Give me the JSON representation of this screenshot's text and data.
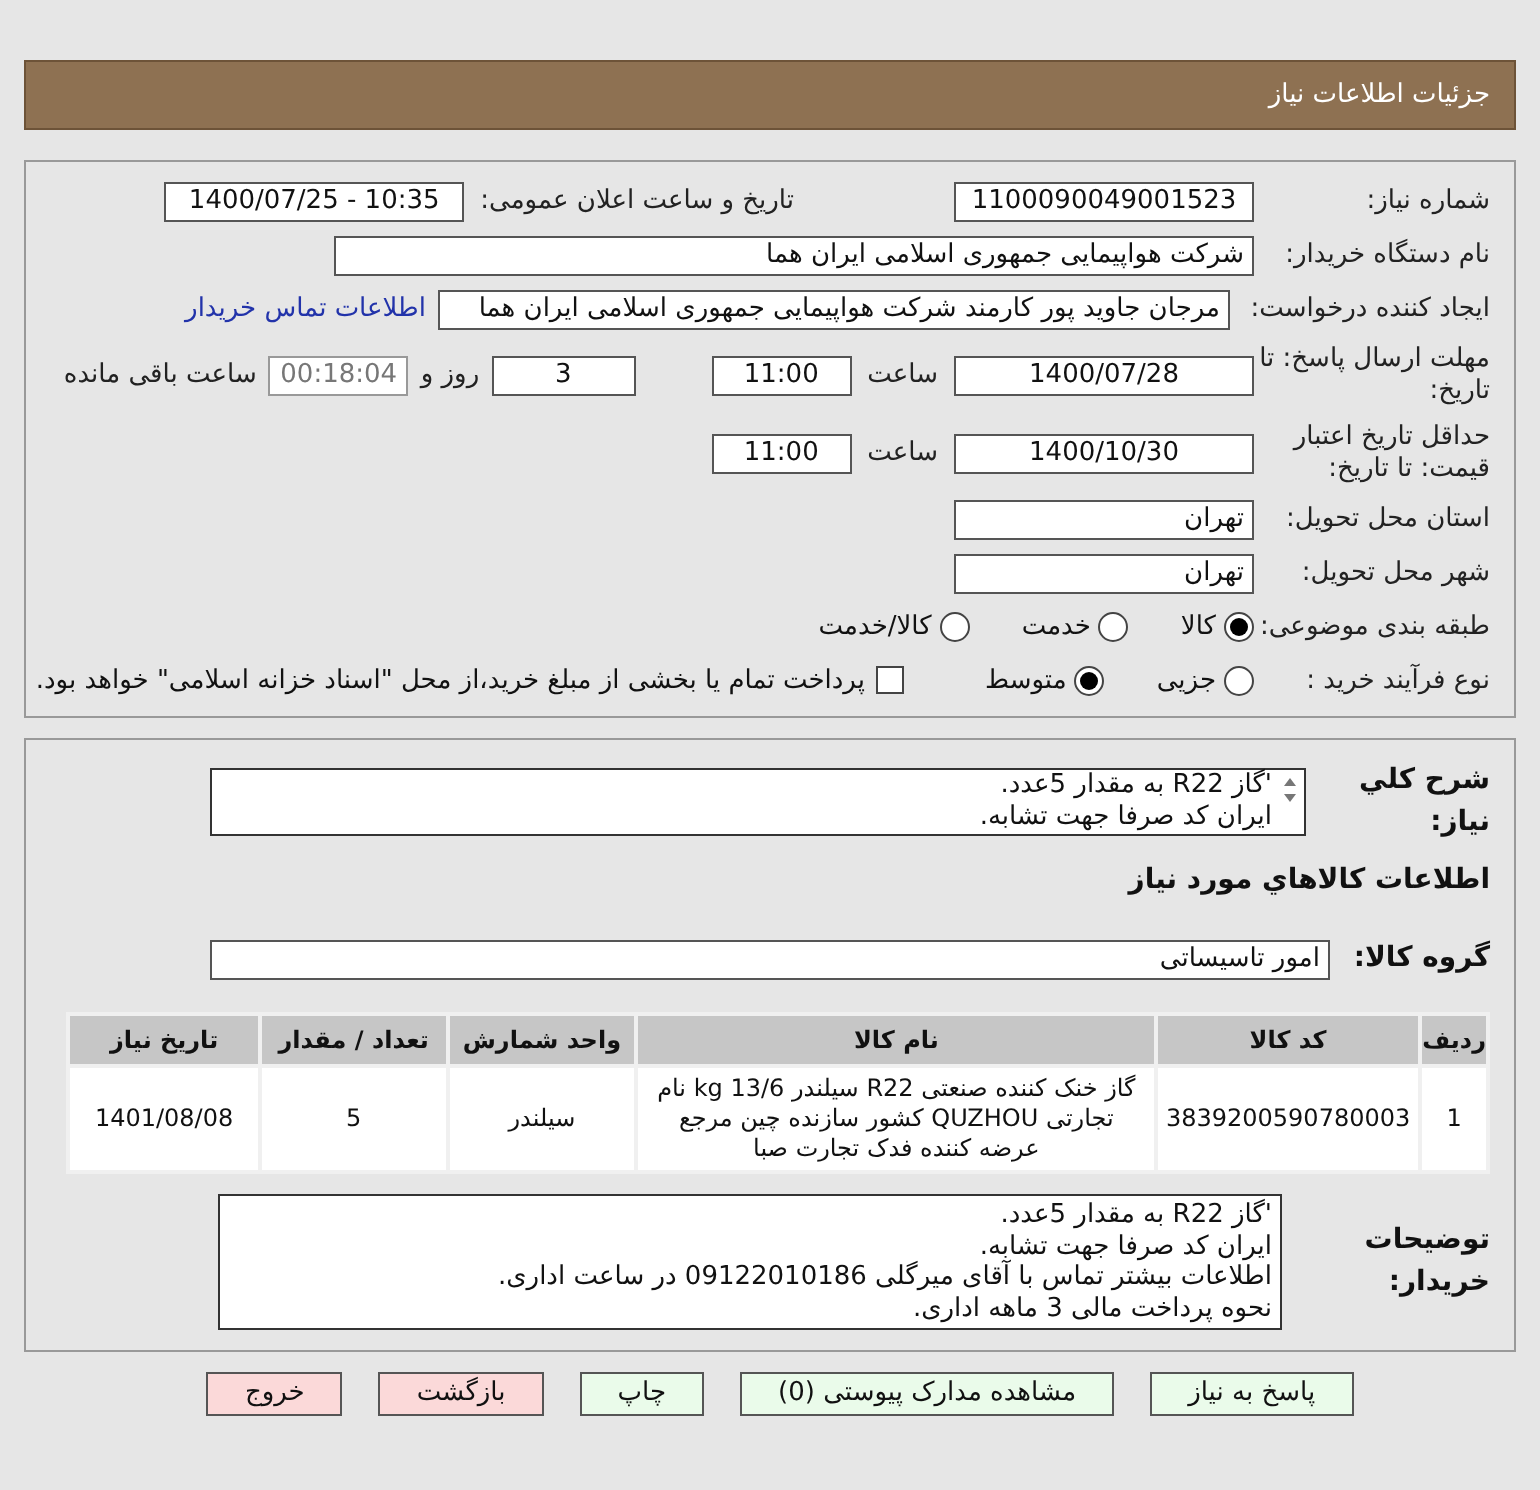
{
  "header": {
    "title": "جزئیات اطلاعات نیاز"
  },
  "info": {
    "need_number": {
      "label": "شماره نیاز:",
      "value": "1100090049001523"
    },
    "announce": {
      "label": "تاریخ و ساعت اعلان عمومی:",
      "value": "1400/07/25 - 10:35"
    },
    "buyer": {
      "label": "نام دستگاه خریدار:",
      "value": "شرکت هواپیمایی جمهوری اسلامی ایران هما"
    },
    "requester": {
      "label": "ایجاد کننده درخواست:",
      "value": "مرجان جاوید پور کارمند شرکت هواپیمایی جمهوری اسلامی ایران هما",
      "link": "اطلاعات تماس خریدار"
    },
    "deadline": {
      "label": "مهلت ارسال پاسخ: تا تاریخ:",
      "date": "1400/07/28",
      "time_label": "ساعت",
      "time": "11:00",
      "days": "3",
      "days_label": "روز و",
      "remaining": "00:18:04",
      "remaining_label": "ساعت باقی مانده"
    },
    "validity": {
      "label": "حداقل تاریخ اعتبار قیمت: تا تاریخ:",
      "date": "1400/10/30",
      "time_label": "ساعت",
      "time": "11:00"
    },
    "province": {
      "label": "استان محل تحویل:",
      "value": "تهران"
    },
    "city": {
      "label": "شهر محل تحویل:",
      "value": "تهران"
    },
    "category": {
      "label": "طبقه بندی موضوعی:",
      "options": [
        {
          "label": "کالا",
          "selected": true
        },
        {
          "label": "خدمت",
          "selected": false
        },
        {
          "label": "کالا/خدمت",
          "selected": false
        }
      ]
    },
    "process": {
      "label": "نوع فرآیند خرید :",
      "options": [
        {
          "label": "جزیی",
          "selected": false
        },
        {
          "label": "متوسط",
          "selected": true
        }
      ],
      "payment": {
        "checked": false,
        "text": "پرداخت تمام یا بخشی از مبلغ خرید،از محل \"اسناد خزانه اسلامی\" خواهد بود."
      }
    }
  },
  "description": {
    "label": "شرح کلي نياز:",
    "lines": [
      "'گاز R22 به مقدار 5عدد.",
      "ایران کد صرفا جهت تشابه."
    ]
  },
  "goods_heading": "اطلاعات كالاهاي مورد نياز",
  "group": {
    "label": "گروه کالا:",
    "value": "امور تاسیساتی"
  },
  "table": {
    "columns": [
      "ردیف",
      "کد کالا",
      "نام کالا",
      "واحد شمارش",
      "تعداد / مقدار",
      "تاریخ نیاز"
    ],
    "rows": [
      [
        "1",
        "3839200590780003",
        "گاز خنک کننده صنعتی R22 سیلندر 13/6 kg نام تجارتی QUZHOU کشور سازنده چین مرجع عرضه کننده فدک تجارت صبا",
        "سیلندر",
        "5",
        "1401/08/08"
      ]
    ]
  },
  "buyer_notes": {
    "label": "توضیحات خریدار:",
    "lines": [
      "'گاز R22 به مقدار 5عدد.",
      "ایران کد صرفا جهت تشابه.",
      "اطلاعات بیشتر تماس با آقای میرگلی 09122010186 در ساعت اداری.",
      "نحوه پرداخت مالی 3 ماهه اداری."
    ]
  },
  "buttons": [
    {
      "label": "پاسخ به نیاز",
      "kind": "green"
    },
    {
      "label": "مشاهده مدارک پیوستی (0)",
      "kind": "green"
    },
    {
      "label": "چاپ",
      "kind": "green"
    },
    {
      "label": "بازگشت",
      "kind": "red"
    },
    {
      "label": "خروج",
      "kind": "red"
    }
  ]
}
